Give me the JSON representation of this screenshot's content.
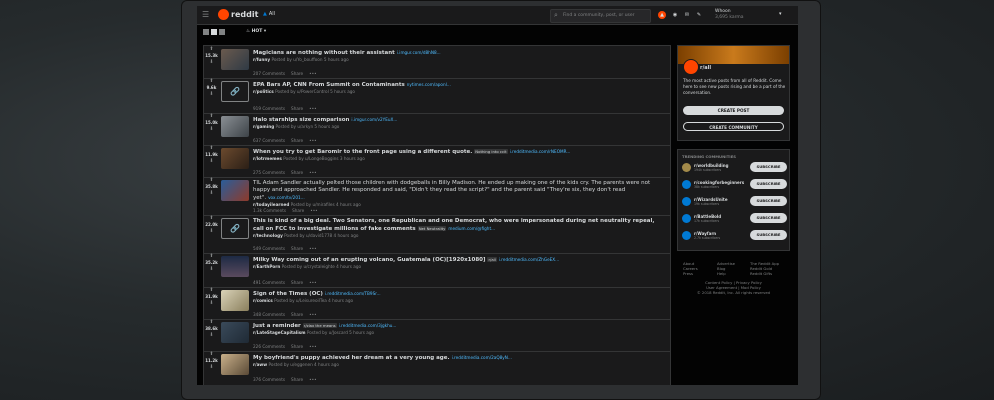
{
  "header": {
    "brand": "reddit",
    "nav_label": "All",
    "search_placeholder": "Find a community, post, or user",
    "username": "Whoon",
    "karma": "3,695 karma",
    "sort_label": "HOT"
  },
  "colors": {
    "accent": "#ff4500",
    "link": "#4fbcff",
    "background": "#030303",
    "card": "#1a1a1b",
    "border": "#343536"
  },
  "posts": [
    {
      "score": "15.3k",
      "title": "Magicians are nothing without their assistant",
      "domain": "i.imgur.com/d8hN8...",
      "flair": "",
      "subreddit": "r/funny",
      "posted": "Posted by u/Yo_bouffoon 5 hours ago",
      "comments": "207 Comments",
      "share": "Share",
      "thumb": "image"
    },
    {
      "score": "9.6k",
      "title": "EPA Bars AP, CNN From Summit on Contaminants",
      "domain": "nytimes.com/aponl...",
      "flair": "",
      "subreddit": "r/politics",
      "posted": "Posted by u/PowerControl 5 hours ago",
      "comments": "919 Comments",
      "share": "Share",
      "thumb": "link"
    },
    {
      "score": "15.0k",
      "title": "Halo starships size comparison",
      "domain": "i.imgur.com/v2YEuX...",
      "flair": "",
      "subreddit": "r/gaming",
      "posted": "Posted by u/arkyn 5 hours ago",
      "comments": "637 Comments",
      "share": "Share",
      "thumb": "image"
    },
    {
      "score": "11.9k",
      "title": "When you try to get Baromir to the front page using a different quote.",
      "domain": "i.redditmedia.com/rNEOMR...",
      "flair": "Nothing into ccit",
      "subreddit": "r/lotrmemes",
      "posted": "Posted by u/LongeBoggins 3 hours ago",
      "comments": "275 Comments",
      "share": "Share",
      "thumb": "image"
    },
    {
      "score": "35.8k",
      "title": "TIL Adam Sandler actually pelted those children with dodgeballs in Billy Madison. He ended up making one of the kids cry. The parents were not happy and approached Sandler. He responded and said, \"Didn't they read the script?\" and the parent said \"They're six, they don't read yet\".",
      "domain": "vox.com/tv/201...",
      "flair": "",
      "subreddit": "r/todayilearned",
      "posted": "Posted by u/mirafiles 4 hours ago",
      "comments": "1.3k Comments",
      "share": "Share",
      "thumb": "image"
    },
    {
      "score": "22.0k",
      "title": "This is kind of a big deal. Two Senators, one Republican and one Democrat, who were impersonated during net neutrality repeal, call on FCC to investigate millions of fake comments",
      "domain": "medium.com/@fight...",
      "flair": "Net Neutrality",
      "subreddit": "r/technology",
      "posted": "Posted by u/david1778 4 hours ago",
      "comments": "549 Comments",
      "share": "Share",
      "thumb": "link"
    },
    {
      "score": "35.2k",
      "title": "Milky Way coming out of an erupting volcano, Guatemala (OC)[1920x1080]",
      "domain": "i.redditmedia.com/ZhGeEX...",
      "flair": "r/all",
      "subreddit": "r/EarthPorn",
      "posted": "Posted by u/crystaleighte 4 hours ago",
      "comments": "491 Comments",
      "share": "Share",
      "thumb": "image"
    },
    {
      "score": "31.9k",
      "title": "Sign of the Times (OC)",
      "domain": "i.redditmedia.com/TB9Sr...",
      "flair": "",
      "subreddit": "r/comics",
      "posted": "Posted by u/LeisureoilTea 4 hours ago",
      "comments": "348 Comments",
      "share": "Share",
      "thumb": "image"
    },
    {
      "score": "38.6k",
      "title": "Just a reminder",
      "domain": "i.redditmedia.com/3jgkhu...",
      "flair": "r/zlax the means",
      "subreddit": "r/LateStageCapitalism",
      "posted": "Posted by u/Joscard 5 hours ago",
      "comments": "226 Comments",
      "share": "Share",
      "thumb": "image"
    },
    {
      "score": "11.2k",
      "title": "My boyfriend's puppy achieved her dream at a very young age.",
      "domain": "i.redditmedia.com/2aQ8yN...",
      "flair": "",
      "subreddit": "r/aww",
      "posted": "Posted by u/eggenen 4 hours ago",
      "comments": "376 Comments",
      "share": "Share",
      "thumb": "image"
    }
  ],
  "sidebar": {
    "home_title": "r/all",
    "home_desc": "The most active posts from all of Reddit. Come here to see new posts rising and be a part of the conversation.",
    "create_post": "CREATE POST",
    "create_community": "CREATE COMMUNITY",
    "trending_title": "TRENDING COMMUNITIES",
    "communities": [
      {
        "name": "r/worldbuilding",
        "subs": "194k subscribers",
        "action": "SUBSCRIBE"
      },
      {
        "name": "r/cookingforbeginners",
        "subs": "38k subscribers",
        "action": "SUBSCRIBE"
      },
      {
        "name": "r/WizardsUnite",
        "subs": "19k subscribers",
        "action": "SUBSCRIBE"
      },
      {
        "name": "r/BattleBold",
        "subs": "17k subscribers",
        "action": "SUBSCRIBE"
      },
      {
        "name": "r/Wayfarn",
        "subs": "2.7k subscribers",
        "action": "SUBSCRIBE"
      }
    ],
    "footer": {
      "col1": [
        "About",
        "Careers",
        "Press"
      ],
      "col2": [
        "Advertise",
        "Blog",
        "Help"
      ],
      "col3": [
        "The Reddit App",
        "Reddit Gold",
        "Reddit Gifts"
      ],
      "policy": "Content Policy | Privacy Policy",
      "agreement": "User Agreement | Mod Policy",
      "copyright": "© 2018 Reddit, Inc. All rights reserved"
    }
  }
}
